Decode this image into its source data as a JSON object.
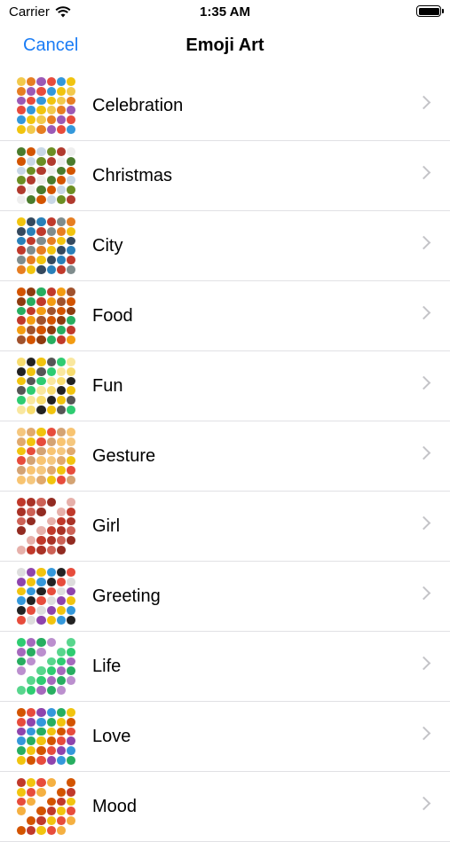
{
  "status": {
    "carrier": "Carrier",
    "time": "1:35 AM"
  },
  "nav": {
    "cancel": "Cancel",
    "title": "Emoji Art"
  },
  "items": [
    {
      "label": "Celebration",
      "colors": [
        "#f2c94c",
        "#e67e22",
        "#9b59b6",
        "#e74c3c",
        "#3498db",
        "#f1c40f"
      ]
    },
    {
      "label": "Christmas",
      "colors": [
        "#4a7b2c",
        "#d35400",
        "#c8d7e6",
        "#6b8e23",
        "#b03a2e",
        "#eeeeee"
      ]
    },
    {
      "label": "City",
      "colors": [
        "#f1c40f",
        "#34495e",
        "#2980b9",
        "#c0392b",
        "#7f8c8d",
        "#e67e22"
      ]
    },
    {
      "label": "Food",
      "colors": [
        "#d35400",
        "#8e3b0f",
        "#27ae60",
        "#c0392b",
        "#f39c12",
        "#a0522d"
      ]
    },
    {
      "label": "Fun",
      "colors": [
        "#f7dc6f",
        "#222222",
        "#f1c40f",
        "#555555",
        "#2ecc71",
        "#f9e79f"
      ]
    },
    {
      "label": "Gesture",
      "colors": [
        "#f5c77e",
        "#e0a96d",
        "#f1c40f",
        "#e74c3c",
        "#d4a373",
        "#f8c471"
      ]
    },
    {
      "label": "Girl",
      "colors": [
        "#c0392b",
        "#a93226",
        "#cd6155",
        "#922b21",
        "#ffffff",
        "#e6b0aa"
      ]
    },
    {
      "label": "Greeting",
      "colors": [
        "#dddddd",
        "#8e44ad",
        "#f1c40f",
        "#3498db",
        "#222222",
        "#e74c3c"
      ]
    },
    {
      "label": "Life",
      "colors": [
        "#2ecc71",
        "#a569bd",
        "#27ae60",
        "#bb8fce",
        "#ffffff",
        "#58d68d"
      ]
    },
    {
      "label": "Love",
      "colors": [
        "#d35400",
        "#e74c3c",
        "#8e44ad",
        "#3498db",
        "#27ae60",
        "#f1c40f"
      ]
    },
    {
      "label": "Mood",
      "colors": [
        "#c0392b",
        "#f1c40f",
        "#e74c3c",
        "#f5b041",
        "#ffffff",
        "#d35400"
      ]
    }
  ]
}
